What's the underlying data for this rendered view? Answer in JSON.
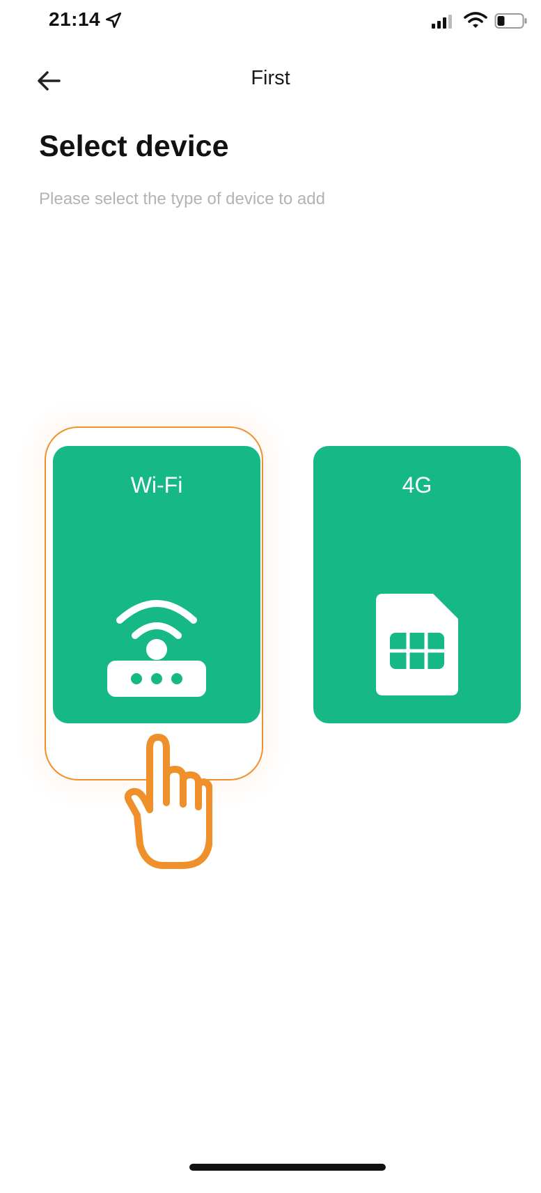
{
  "status_bar": {
    "time": "21:14",
    "icons": [
      "location-arrow-icon",
      "cellular-signal-icon",
      "wifi-icon",
      "battery-icon"
    ]
  },
  "nav": {
    "title": "First",
    "back_icon": "arrow-left-icon"
  },
  "header": {
    "title": "Select device",
    "subtitle": "Please select the type of device to add"
  },
  "devices": [
    {
      "label": "Wi-Fi",
      "icon": "router-icon",
      "selected": true
    },
    {
      "label": "4G",
      "icon": "sim-card-icon",
      "selected": false
    }
  ],
  "colors": {
    "card_green": "#16b985",
    "highlight_orange": "#f0902a",
    "subtitle_gray": "#b3b3b3"
  },
  "hint": {
    "icon": "tap-hand-icon"
  }
}
